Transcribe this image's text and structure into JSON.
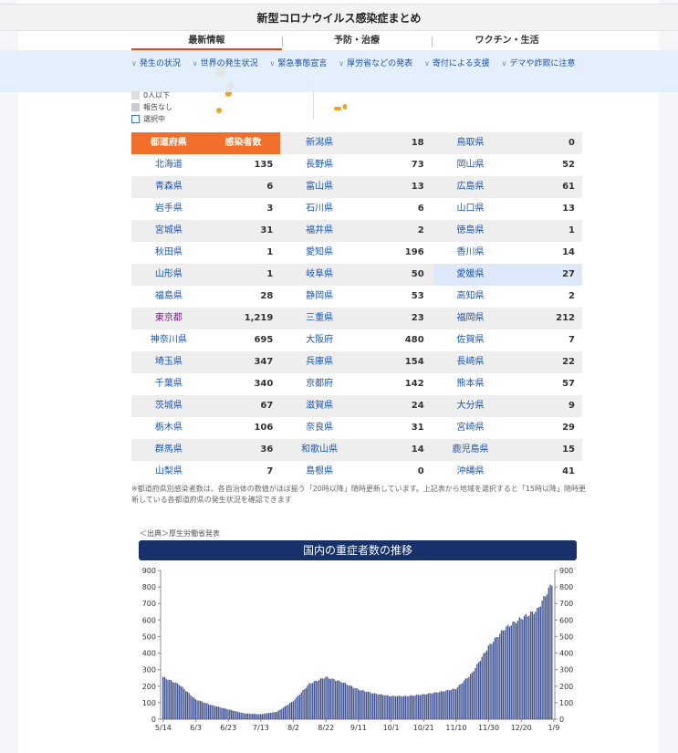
{
  "header": {
    "title": "新型コロナウイルス感染症まとめ"
  },
  "tabs": [
    {
      "label": "最新情報",
      "active": true
    },
    {
      "label": "予防・治療",
      "active": false
    },
    {
      "label": "ワクチン・生活",
      "active": false
    }
  ],
  "subnav": [
    "発生の状況",
    "世界の発生状況",
    "緊急事態宣言",
    "厚労省などの発表",
    "寄付による支援",
    "デマや詐欺に注意"
  ],
  "map_legend": {
    "items": [
      "0人以下",
      "報告なし",
      "選択中"
    ],
    "colors": [
      "#dddddd",
      "#cccccc",
      "#3a75d6"
    ]
  },
  "colors": {
    "accent": "#f26f2b",
    "link": "#1a56b8",
    "chart_bar": "#3d4f8e",
    "title_bar": "#17326b"
  },
  "table": {
    "header": {
      "name": "都道府県",
      "count": "感染者数"
    },
    "rows": [
      [
        [
          "",
          ""
        ],
        [
          "新潟県",
          "18"
        ],
        [
          "鳥取県",
          "0"
        ]
      ],
      [
        [
          "北海道",
          "135"
        ],
        [
          "長野県",
          "73"
        ],
        [
          "岡山県",
          "52"
        ]
      ],
      [
        [
          "青森県",
          "6"
        ],
        [
          "富山県",
          "13"
        ],
        [
          "広島県",
          "61"
        ]
      ],
      [
        [
          "岩手県",
          "3"
        ],
        [
          "石川県",
          "6"
        ],
        [
          "山口県",
          "13"
        ]
      ],
      [
        [
          "宮城県",
          "31"
        ],
        [
          "福井県",
          "2"
        ],
        [
          "徳島県",
          "1"
        ]
      ],
      [
        [
          "秋田県",
          "1"
        ],
        [
          "愛知県",
          "196"
        ],
        [
          "香川県",
          "14"
        ]
      ],
      [
        [
          "山形県",
          "1"
        ],
        [
          "岐阜県",
          "50"
        ],
        [
          "愛媛県",
          "27"
        ]
      ],
      [
        [
          "福島県",
          "28"
        ],
        [
          "静岡県",
          "53"
        ],
        [
          "高知県",
          "2"
        ]
      ],
      [
        [
          "東京都",
          "1,219"
        ],
        [
          "三重県",
          "23"
        ],
        [
          "福岡県",
          "212"
        ]
      ],
      [
        [
          "神奈川県",
          "695"
        ],
        [
          "大阪府",
          "480"
        ],
        [
          "佐賀県",
          "7"
        ]
      ],
      [
        [
          "埼玉県",
          "347"
        ],
        [
          "兵庫県",
          "154"
        ],
        [
          "長崎県",
          "22"
        ]
      ],
      [
        [
          "千葉県",
          "340"
        ],
        [
          "京都府",
          "142"
        ],
        [
          "熊本県",
          "57"
        ]
      ],
      [
        [
          "茨城県",
          "67"
        ],
        [
          "滋賀県",
          "24"
        ],
        [
          "大分県",
          "9"
        ]
      ],
      [
        [
          "栃木県",
          "106"
        ],
        [
          "奈良県",
          "31"
        ],
        [
          "宮崎県",
          "29"
        ]
      ],
      [
        [
          "群馬県",
          "36"
        ],
        [
          "和歌山県",
          "14"
        ],
        [
          "鹿児島県",
          "15"
        ]
      ],
      [
        [
          "山梨県",
          "7"
        ],
        [
          "島根県",
          "0"
        ],
        [
          "沖縄県",
          "41"
        ]
      ]
    ],
    "selected": "愛媛県"
  },
  "note": "※都道府県別感染者数は、各自治体の数値がほぼ揃う「20時以降」随時更新しています。上記表から地域を選択すると「15時以降」随時更新している各都道府県の発生状況を確認できます",
  "source": "＜出典＞厚生労働省発表",
  "chart_data": {
    "type": "bar",
    "title": "国内の重症者数の推移",
    "xlabel": "",
    "ylabel": "",
    "ylim": [
      0,
      900
    ],
    "yticks": [
      0,
      100,
      200,
      300,
      400,
      500,
      600,
      700,
      800,
      900
    ],
    "xticks": [
      "5/14",
      "6/3",
      "6/23",
      "7/13",
      "8/2",
      "8/22",
      "9/11",
      "10/1",
      "10/21",
      "11/10",
      "11/30",
      "12/20",
      "1/9"
    ],
    "grid": false,
    "key_points": [
      [
        "5/14",
        255
      ],
      [
        "5/24",
        210
      ],
      [
        "6/3",
        120
      ],
      [
        "6/13",
        85
      ],
      [
        "6/23",
        60
      ],
      [
        "7/3",
        35
      ],
      [
        "7/13",
        30
      ],
      [
        "7/23",
        45
      ],
      [
        "8/2",
        110
      ],
      [
        "8/12",
        215
      ],
      [
        "8/22",
        255
      ],
      [
        "9/1",
        225
      ],
      [
        "9/11",
        180
      ],
      [
        "9/21",
        155
      ],
      [
        "10/1",
        140
      ],
      [
        "10/11",
        140
      ],
      [
        "10/21",
        150
      ],
      [
        "10/31",
        165
      ],
      [
        "11/10",
        185
      ],
      [
        "11/20",
        280
      ],
      [
        "11/30",
        440
      ],
      [
        "12/10",
        550
      ],
      [
        "12/20",
        610
      ],
      [
        "12/30",
        660
      ],
      [
        "1/9",
        840
      ]
    ]
  }
}
